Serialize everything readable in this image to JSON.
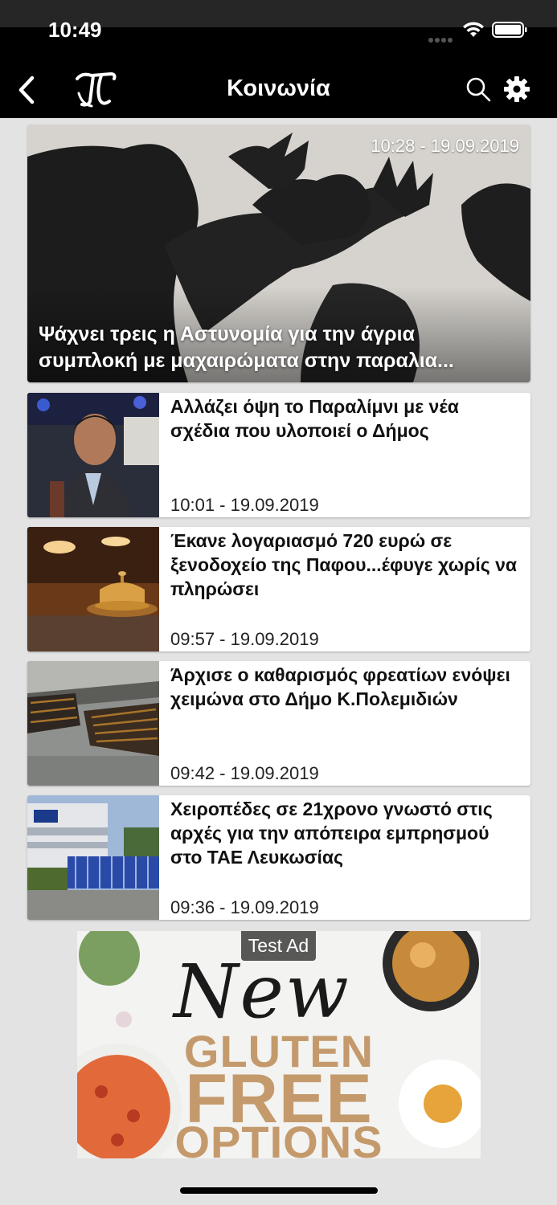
{
  "status": {
    "time": "10:49"
  },
  "nav": {
    "title": "Κοινωνία"
  },
  "hero": {
    "timestamp": "10:28 - 19.09.2019",
    "headline_line1": "Ψάχνει τρεις η Αστυνομία για την άγρια",
    "headline_line2": "συμπλοκή με μαχαιρώματα στην παραλια..."
  },
  "articles": [
    {
      "title": "Αλλάζει όψη το Παραλίμνι με νέα σχέδια που υλοποιεί ο Δήμος",
      "timestamp": "10:01 - 19.09.2019"
    },
    {
      "title": "Έκανε λογαριασμό 720 ευρώ σε ξενοδοχείο της Παφου...έφυγε χωρίς να πληρώσει",
      "timestamp": "09:57 - 19.09.2019"
    },
    {
      "title": "Άρχισε ο καθαρισμός φρεατίων ενόψει χειμώνα στο Δήμο Κ.Πολεμιδιών",
      "timestamp": "09:42 - 19.09.2019"
    },
    {
      "title": "Χειροπέδες σε 21χρονο γνωστό στις αρχές για την απόπειρα εμπρησμού στο ΤΑΕ Λευκωσίας",
      "timestamp": "09:36 - 19.09.2019"
    }
  ],
  "ad": {
    "badge": "Test Ad",
    "script_text": "New",
    "line1": "GLUTEN",
    "line2": "FREE",
    "line3": "OPTIONS"
  },
  "icons": {
    "back": "chevron-left-icon",
    "logo": "site-logo",
    "search": "search-icon",
    "settings": "gear-icon"
  }
}
